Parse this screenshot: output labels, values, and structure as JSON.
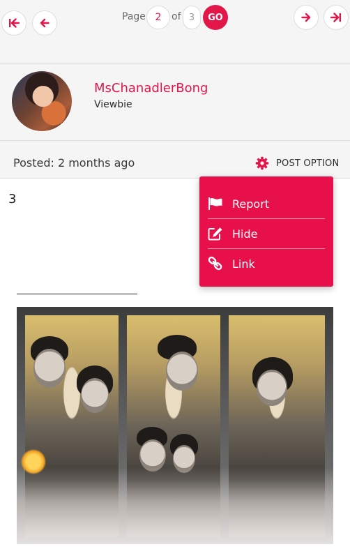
{
  "pager": {
    "page_label": "Page",
    "current_page": "2",
    "of_label": "of",
    "total_pages": "3",
    "go_label": "GO"
  },
  "profile": {
    "username": "MsChanadlerBong",
    "rank": "Viewbie"
  },
  "post": {
    "posted": "Posted: 2 months ago",
    "option_label": "POST OPTION",
    "number": "3"
  },
  "dropdown": {
    "items": [
      {
        "label": "Report",
        "icon": "flag-icon"
      },
      {
        "label": "Hide",
        "icon": "edit-icon"
      },
      {
        "label": "Link",
        "icon": "link-icon"
      }
    ]
  },
  "colors": {
    "accent": "#e3164a",
    "menu_bg": "#e8104a",
    "bar_bg": "#f5f5f5"
  }
}
